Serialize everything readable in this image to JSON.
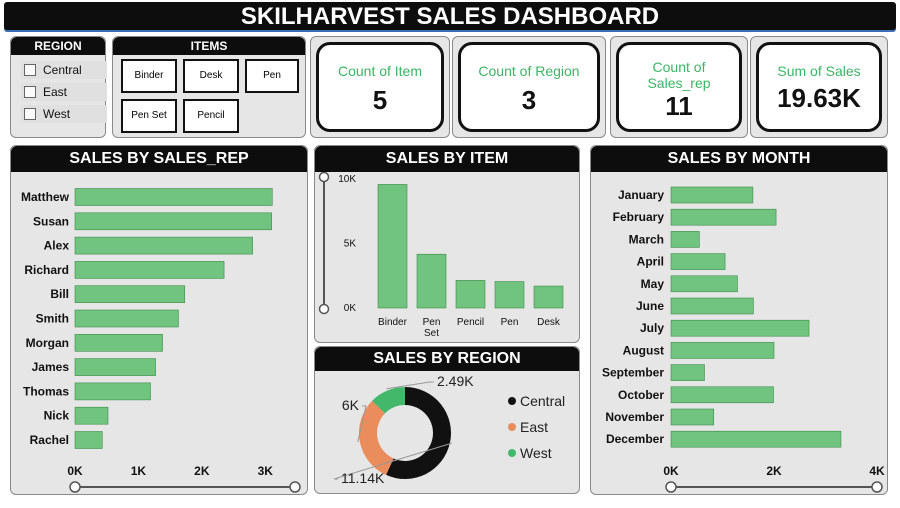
{
  "title": "SKILHARVEST SALES DASHBOARD",
  "region_slicer": {
    "header": "REGION",
    "items": [
      "Central",
      "East",
      "West"
    ]
  },
  "items_slicer": {
    "header": "ITEMS",
    "items": [
      "Binder",
      "Desk",
      "Pen",
      "Pen Set",
      "Pencil"
    ]
  },
  "cards": [
    {
      "label": "Count of Item",
      "value": "5"
    },
    {
      "label": "Count of Region",
      "value": "3"
    },
    {
      "label": "Count of Sales_rep",
      "value": "11"
    },
    {
      "label": "Sum of Sales",
      "value": "19.63K"
    }
  ],
  "colors": {
    "bar": "#71c47f",
    "bar_stroke": "#3c8a4a",
    "central": "#111111",
    "east": "#ea8c5c",
    "west": "#44b86a",
    "accent": "#3cb564"
  },
  "chart_data": [
    {
      "type": "bar",
      "orientation": "horizontal",
      "title": "SALES BY SALES_REP",
      "categories": [
        "Matthew",
        "Susan",
        "Alex",
        "Richard",
        "Bill",
        "Smith",
        "Morgan",
        "James",
        "Thomas",
        "Nick",
        "Rachel"
      ],
      "values": [
        3110,
        3100,
        2800,
        2350,
        1730,
        1630,
        1380,
        1270,
        1190,
        520,
        430
      ],
      "xlim": [
        0,
        3500
      ],
      "ticks": [
        0,
        1000,
        2000,
        3000
      ],
      "tick_labels": [
        "0K",
        "1K",
        "2K",
        "3K"
      ]
    },
    {
      "type": "bar",
      "orientation": "vertical",
      "title": "SALES BY ITEM",
      "categories": [
        "Binder",
        "Pen Set",
        "Pencil",
        "Pen",
        "Desk"
      ],
      "values": [
        9580,
        4170,
        2140,
        2050,
        1700
      ],
      "ylim": [
        0,
        10000
      ],
      "ticks": [
        0,
        5000,
        10000
      ],
      "tick_labels": [
        "0K",
        "5K",
        "10K"
      ]
    },
    {
      "type": "pie",
      "donut": true,
      "title": "SALES BY REGION",
      "categories": [
        "Central",
        "East",
        "West"
      ],
      "values": [
        11.14,
        6,
        2.49
      ],
      "data_labels": [
        "11.14K",
        "6K",
        "2.49K"
      ],
      "legend": "right"
    },
    {
      "type": "bar",
      "orientation": "horizontal",
      "title": "SALES BY MONTH",
      "categories": [
        "January",
        "February",
        "March",
        "April",
        "May",
        "June",
        "July",
        "August",
        "September",
        "October",
        "November",
        "December"
      ],
      "values": [
        1590,
        2040,
        550,
        1050,
        1290,
        1600,
        2680,
        2000,
        650,
        1990,
        830,
        3300
      ],
      "xlim": [
        0,
        4000
      ],
      "ticks": [
        0,
        2000,
        4000
      ],
      "tick_labels": [
        "0K",
        "2K",
        "4K"
      ]
    }
  ]
}
